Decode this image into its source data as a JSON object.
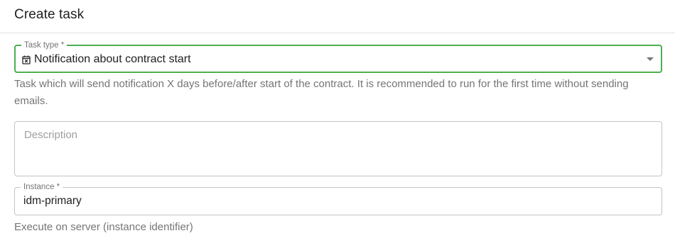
{
  "dialog": {
    "title": "Create task"
  },
  "task_type": {
    "label": "Task type *",
    "selected_value": "Notification about contract start",
    "icon": "calendar-x-icon",
    "helper": "Task which will send notification X days before/after start of the contract. It is recommended to run for the first time without sending emails.",
    "border_color": "#4caf50"
  },
  "description": {
    "placeholder": "Description",
    "value": ""
  },
  "instance": {
    "label": "Instance *",
    "value": "idm-primary",
    "helper": "Execute on server (instance identifier)"
  }
}
